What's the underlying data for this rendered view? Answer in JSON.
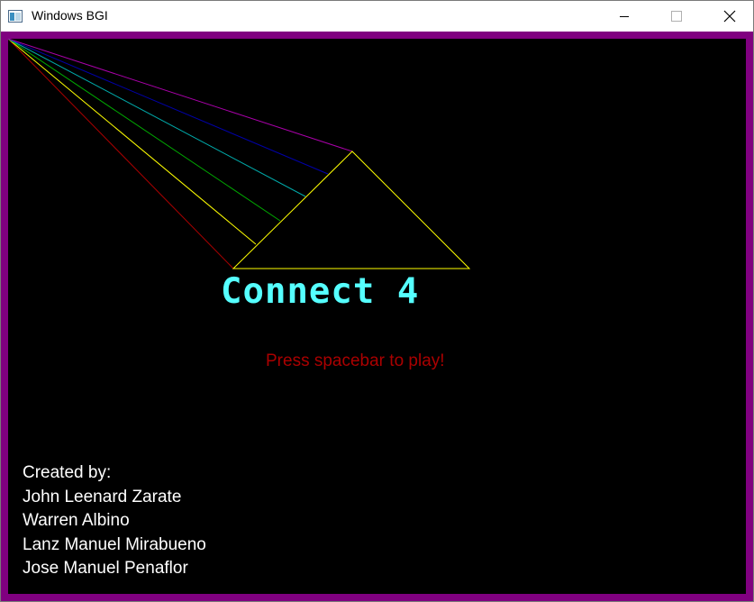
{
  "window": {
    "title": "Windows BGI",
    "icon": "window-app-icon",
    "controls": {
      "minimize_icon": "minimize-icon",
      "maximize_icon": "maximize-icon",
      "close_icon": "close-icon"
    }
  },
  "game": {
    "title": "Connect 4",
    "prompt": "Press spacebar to play!",
    "credits": {
      "heading": "Created by:",
      "names": [
        "John Leenard Zarate",
        "Warren Albino",
        "Lanz Manuel Mirabueno",
        "Jose Manuel Penaflor"
      ]
    }
  },
  "colors": {
    "frame": "#800080",
    "background": "#000000",
    "title": "#55ffff",
    "prompt": "#aa0000",
    "credits": "#ffffff",
    "triangle": "#ffff00",
    "rays": [
      "#aa0000",
      "#ffff00",
      "#00aa00",
      "#00aaaa",
      "#0000aa",
      "#aa00aa"
    ]
  }
}
